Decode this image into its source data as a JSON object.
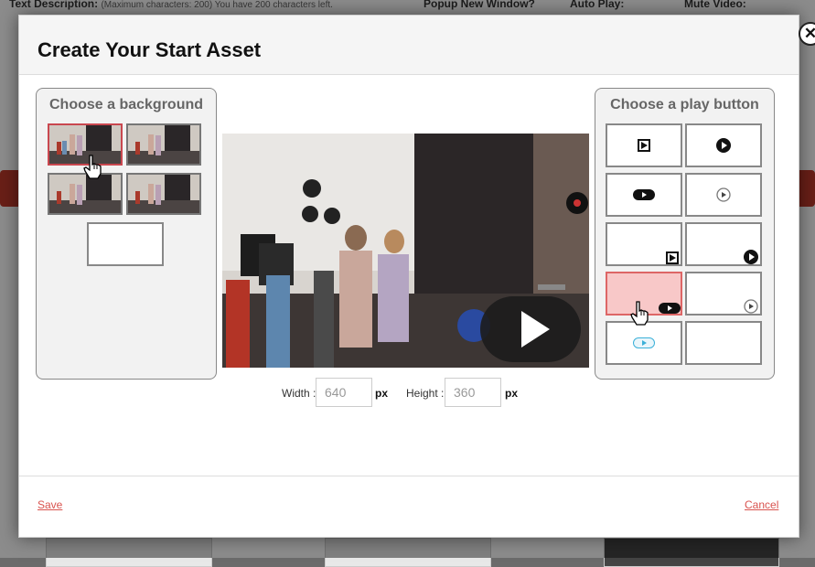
{
  "background_page": {
    "text_description_label": "Text Description:",
    "text_description_hint": "(Maximum characters: 200) You have 200 characters left.",
    "popup_label": "Popup New Window?",
    "autoplay_label": "Auto Play:",
    "mute_label": "Mute Video:"
  },
  "modal": {
    "title": "Create Your Start Asset",
    "close_symbol": "✕",
    "background_panel": {
      "title": "Choose a background"
    },
    "play_panel": {
      "title": "Choose a play button"
    },
    "width_label": "Width :",
    "width_value": "640",
    "height_label": "Height :",
    "height_value": "360",
    "unit": "px",
    "save_label": "Save",
    "cancel_label": "Cancel"
  },
  "colors": {
    "accent_red": "#d9534f",
    "selected_fill": "#f8c8c8",
    "panel_bg": "#f2f2f2"
  },
  "icons": [
    "close-icon",
    "play-button-icon",
    "hand-cursor-icon"
  ]
}
